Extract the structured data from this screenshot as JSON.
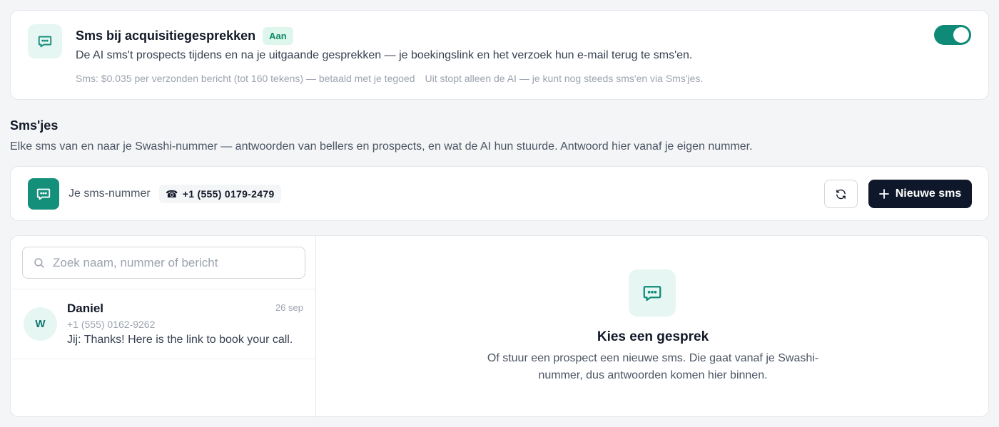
{
  "ai_card": {
    "title": "Sms bij acquisitiegesprekken",
    "status_badge": "Aan",
    "description": "De AI sms't prospects tijdens en na je uitgaande gesprekken — je boekingslink en het verzoek hun e-mail terug te sms'en.",
    "pricing": "Sms: $0.035 per verzonden bericht (tot 160 tekens) — betaald met je tegoed",
    "note": "Uit stopt alleen de AI — je kunt nog steeds sms'en via Sms'jes.",
    "toggle_on": true,
    "icon": "chat-bubble-icon"
  },
  "section": {
    "title": "Sms'jes",
    "description": "Elke sms van en naar je Swashi-nummer — antwoorden van bellers en prospects, en wat de AI hun stuurde. Antwoord hier vanaf je eigen nummer."
  },
  "number_bar": {
    "label": "Je sms-nummer",
    "phone_glyph": "☎",
    "phone": "+1 (555) 0179-2479",
    "refresh_icon": "refresh-icon",
    "new_sms_label": "Nieuwe sms"
  },
  "search": {
    "placeholder": "Zoek naam, nummer of bericht"
  },
  "conversations": [
    {
      "initial": "W",
      "name": "Daniel",
      "date": "26 sep",
      "phone": "+1 (555) 0162-9262",
      "last_message": "Jij: Thanks! Here is the link to book your call."
    }
  ],
  "empty_state": {
    "title": "Kies een gesprek",
    "description": "Of stuur een prospect een nieuwe sms. Die gaat vanaf je Swashi-nummer, dus antwoorden komen hier binnen."
  },
  "colors": {
    "accent": "#148f7a",
    "accent_light": "#e6f6f2",
    "primary_button": "#0f172a",
    "badge_text": "#0f8a68"
  }
}
